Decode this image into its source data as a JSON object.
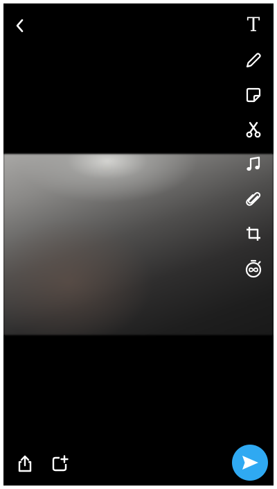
{
  "screen": {
    "background": "#000000",
    "media": "blurred-photo"
  },
  "topbar": {
    "back_icon": "chevron-left-icon"
  },
  "tools": [
    {
      "name": "text",
      "icon": "text-icon",
      "glyph": "T"
    },
    {
      "name": "draw",
      "icon": "pencil-icon"
    },
    {
      "name": "sticker",
      "icon": "sticker-icon"
    },
    {
      "name": "scissors",
      "icon": "scissors-icon"
    },
    {
      "name": "music",
      "icon": "music-note-icon"
    },
    {
      "name": "attachment",
      "icon": "paperclip-icon"
    },
    {
      "name": "crop",
      "icon": "crop-icon"
    },
    {
      "name": "timer",
      "icon": "infinity-timer-icon"
    }
  ],
  "bottombar": {
    "share_icon": "share-icon",
    "add_story_icon": "add-story-icon",
    "send_icon": "send-arrow-icon",
    "send_color": "#2fa9f2"
  }
}
